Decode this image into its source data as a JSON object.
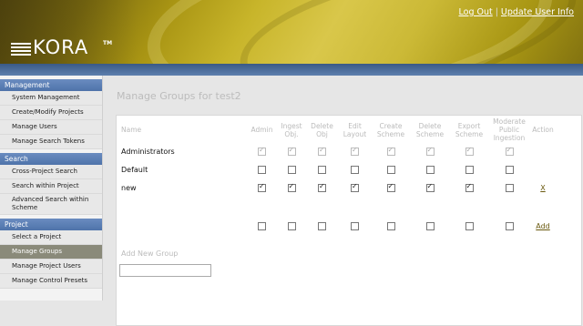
{
  "header": {
    "logo_text": "KORA",
    "logo_tm": "TM",
    "logout_label": "Log Out",
    "separator": "|",
    "update_user_info_label": "Update User Info",
    "brand_color": "#c8b52a"
  },
  "sidebar": {
    "sections": [
      {
        "title": "Management",
        "items": [
          "System Management",
          "Create/Modify Projects",
          "Manage Users",
          "Manage Search Tokens"
        ]
      },
      {
        "title": "Search",
        "items": [
          "Cross-Project Search",
          "Search within Project",
          "Advanced Search within Scheme"
        ]
      },
      {
        "title": "Project",
        "items": [
          "Select a Project",
          "Manage Groups",
          "Manage Project Users",
          "Manage Control Presets"
        ]
      }
    ],
    "active_item": "Manage Groups"
  },
  "main": {
    "title": "Manage Groups for test2",
    "columns": [
      "Name",
      "Admin",
      "Ingest Obj.",
      "Delete Obj",
      "Edit Layout",
      "Create Scheme",
      "Delete Scheme",
      "Export Scheme",
      "Moderate Public Ingestion",
      "Action"
    ],
    "groups": [
      {
        "name": "Administrators",
        "perms": [
          true,
          true,
          true,
          true,
          true,
          true,
          true,
          true
        ],
        "locked": true,
        "action": ""
      },
      {
        "name": "Default",
        "perms": [
          false,
          false,
          false,
          false,
          false,
          false,
          false,
          false
        ],
        "locked": false,
        "action": ""
      },
      {
        "name": "new",
        "perms": [
          true,
          true,
          true,
          true,
          true,
          true,
          true,
          false
        ],
        "locked": false,
        "action": "X"
      }
    ],
    "add_new_group_label": "Add New Group",
    "new_group_input_value": "",
    "add_label": "Add"
  }
}
